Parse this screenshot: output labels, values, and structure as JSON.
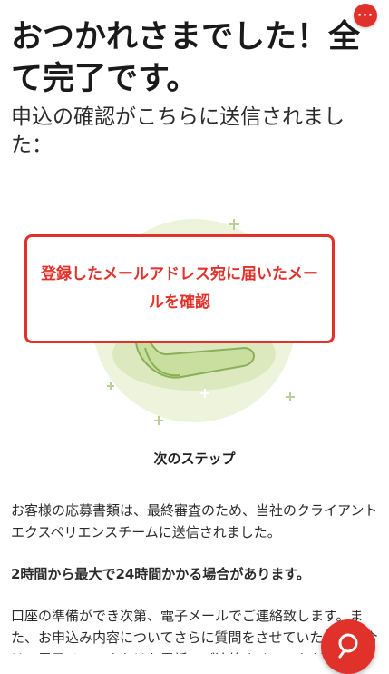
{
  "header": {
    "more_label": "···"
  },
  "title": "おつかれさまでした！全て完了です。",
  "subtitle": "申込の確認がこちらに送信されました：",
  "highlight": "登録したメールアドレス宛に届いたメールを確認",
  "next_step_title": "次のステップ",
  "paragraphs": {
    "p1": "お客様の応募書類は、最終審査のため、当社のクライアントエクスペリエンスチームに送信されました。",
    "p2": "2時間から最大で24時間かかる場合があります。",
    "p3": "口座の準備ができ次第、電子メールでご連絡致します。また、お申込み内容についてさらに質問をさせていただく場合は、電子メールまたはお電話でご連絡させていただきます。"
  },
  "icons": {
    "more": "more-dots-icon",
    "fab": "search-chat-icon"
  },
  "colors": {
    "accent": "#e0322b",
    "illustration_green": "#c9dfa0",
    "illustration_light": "#eef4dc"
  }
}
